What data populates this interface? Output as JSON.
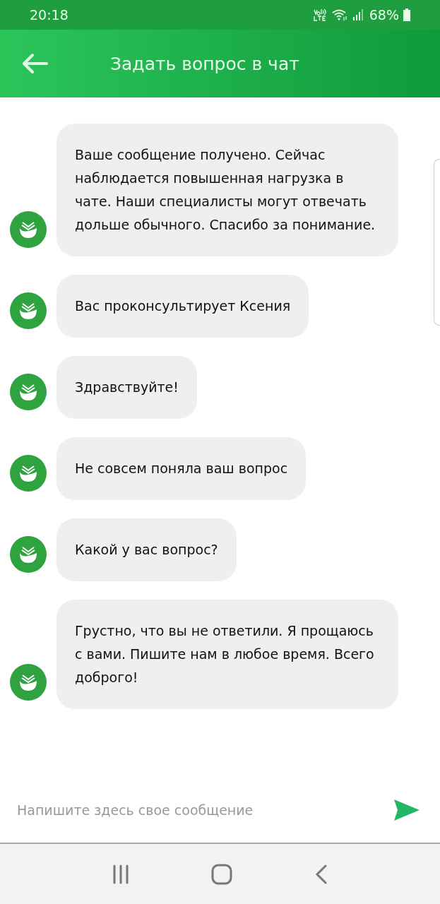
{
  "status_bar": {
    "time": "20:18",
    "battery": "68%"
  },
  "header": {
    "title": "Задать вопрос в чат"
  },
  "messages": [
    {
      "text": "Ваше сообщение получено. Сейчас наблюдается повышенная нагрузка в чате. Наши специалисты могут отвечать дольше обычного. Спасибо за понимание."
    },
    {
      "text": "Вас проконсультирует Ксения"
    },
    {
      "text": "Здравствуйте!"
    },
    {
      "text": "Не совсем поняла ваш вопрос"
    },
    {
      "text": "Какой у вас вопрос?"
    },
    {
      "text": "Грустно, что вы не ответили. Я прощаюсь с вами. Пишите нам в любое время. Всего доброго!"
    }
  ],
  "composer": {
    "placeholder": "Напишите здесь свое сообщение"
  }
}
